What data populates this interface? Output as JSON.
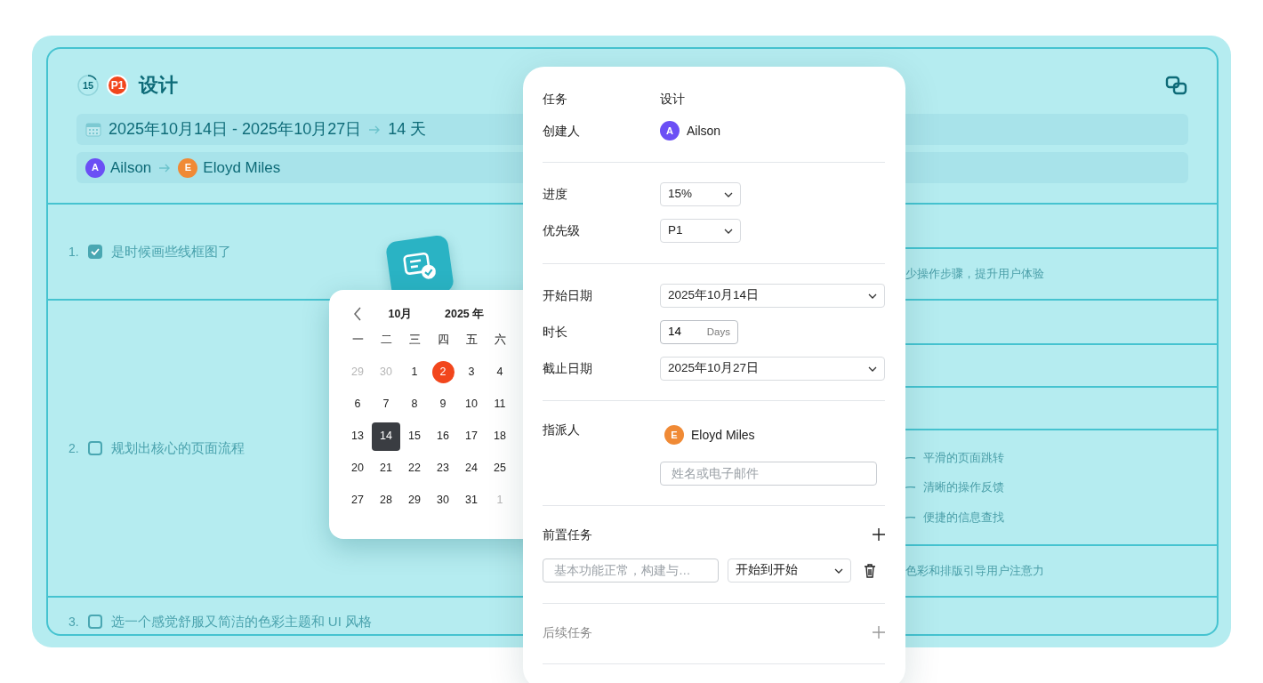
{
  "task_card": {
    "progress": {
      "text": "15"
    },
    "priority": "P1",
    "title": "设计",
    "date_range": "2025年10月14日 - 2025年10月27日",
    "duration": "14 天",
    "people": [
      {
        "initial": "A",
        "name": "Ailson",
        "color": "#6b4ff5"
      },
      {
        "initial": "E",
        "name": "Eloyd Miles",
        "color": "#f08a35"
      }
    ]
  },
  "checklist": [
    {
      "number": "1.",
      "checked": true,
      "text": "是时候画些线框图了",
      "notes": [
        {
          "kind": "empty"
        },
        {
          "kind": "text",
          "text": "少操作步骤，提升用户体验"
        }
      ]
    },
    {
      "number": "2.",
      "checked": false,
      "text": "规划出核心的页面流程",
      "notes": [
        {
          "kind": "empty"
        },
        {
          "kind": "empty"
        },
        {
          "kind": "empty"
        },
        {
          "kind": "branches",
          "items": [
            "平滑的页面跳转",
            "清晰的操作反馈",
            "便捷的信息查找"
          ]
        },
        {
          "kind": "text",
          "text": "色彩和排版引导用户注意力"
        }
      ]
    },
    {
      "number": "3.",
      "checked": false,
      "text": "选一个感觉舒服又简洁的色彩主题和 UI 风格"
    }
  ],
  "calendar": {
    "month": "10月",
    "year": "2025 年",
    "weekdays": [
      "一",
      "二",
      "三",
      "四",
      "五",
      "六"
    ],
    "weeks": [
      [
        {
          "day": "29",
          "outside": true,
          "today": false,
          "selected": false
        },
        {
          "day": "30",
          "outside": true,
          "today": false,
          "selected": false
        },
        {
          "day": "1",
          "outside": false,
          "today": false,
          "selected": false
        },
        {
          "day": "2",
          "outside": false,
          "today": true,
          "selected": false
        },
        {
          "day": "3",
          "outside": false,
          "today": false,
          "selected": false
        },
        {
          "day": "4",
          "outside": false,
          "today": false,
          "selected": false
        }
      ],
      [
        {
          "day": "6",
          "outside": false,
          "today": false,
          "selected": false
        },
        {
          "day": "7",
          "outside": false,
          "today": false,
          "selected": false
        },
        {
          "day": "8",
          "outside": false,
          "today": false,
          "selected": false
        },
        {
          "day": "9",
          "outside": false,
          "today": false,
          "selected": false
        },
        {
          "day": "10",
          "outside": false,
          "today": false,
          "selected": false
        },
        {
          "day": "11",
          "outside": false,
          "today": false,
          "selected": false
        }
      ],
      [
        {
          "day": "13",
          "outside": false,
          "today": false,
          "selected": false
        },
        {
          "day": "14",
          "outside": false,
          "today": false,
          "selected": true
        },
        {
          "day": "15",
          "outside": false,
          "today": false,
          "selected": false
        },
        {
          "day": "16",
          "outside": false,
          "today": false,
          "selected": false
        },
        {
          "day": "17",
          "outside": false,
          "today": false,
          "selected": false
        },
        {
          "day": "18",
          "outside": false,
          "today": false,
          "selected": false
        }
      ],
      [
        {
          "day": "20",
          "outside": false,
          "today": false,
          "selected": false
        },
        {
          "day": "21",
          "outside": false,
          "today": false,
          "selected": false
        },
        {
          "day": "22",
          "outside": false,
          "today": false,
          "selected": false
        },
        {
          "day": "23",
          "outside": false,
          "today": false,
          "selected": false
        },
        {
          "day": "24",
          "outside": false,
          "today": false,
          "selected": false
        },
        {
          "day": "25",
          "outside": false,
          "today": false,
          "selected": false
        }
      ],
      [
        {
          "day": "27",
          "outside": false,
          "today": false,
          "selected": false
        },
        {
          "day": "28",
          "outside": false,
          "today": false,
          "selected": false
        },
        {
          "day": "29",
          "outside": false,
          "today": false,
          "selected": false
        },
        {
          "day": "30",
          "outside": false,
          "today": false,
          "selected": false
        },
        {
          "day": "31",
          "outside": false,
          "today": false,
          "selected": false
        },
        {
          "day": "1",
          "outside": true,
          "today": false,
          "selected": false
        }
      ]
    ]
  },
  "details": {
    "task": {
      "label": "任务",
      "value": "设计"
    },
    "creator": {
      "label": "创建人",
      "initial": "A",
      "name": "Ailson",
      "color": "#6b4ff5"
    },
    "progress": {
      "label": "进度",
      "value": "15%"
    },
    "priority": {
      "label": "优先级",
      "value": "P1"
    },
    "start_date": {
      "label": "开始日期",
      "value": "2025年10月14日"
    },
    "duration": {
      "label": "时长",
      "value": "14",
      "unit": "Days"
    },
    "due_date": {
      "label": "截止日期",
      "value": "2025年10月27日"
    },
    "assignee": {
      "label": "指派人",
      "initial": "E",
      "name": "Eloyd Miles",
      "color": "#f08a35",
      "placeholder": "姓名或电子邮件"
    },
    "predecessors": {
      "label": "前置任务",
      "items": [
        {
          "placeholder": "基本功能正常，构建与…",
          "relation": "开始到开始"
        }
      ]
    },
    "successors": {
      "label": "后续任务"
    }
  }
}
